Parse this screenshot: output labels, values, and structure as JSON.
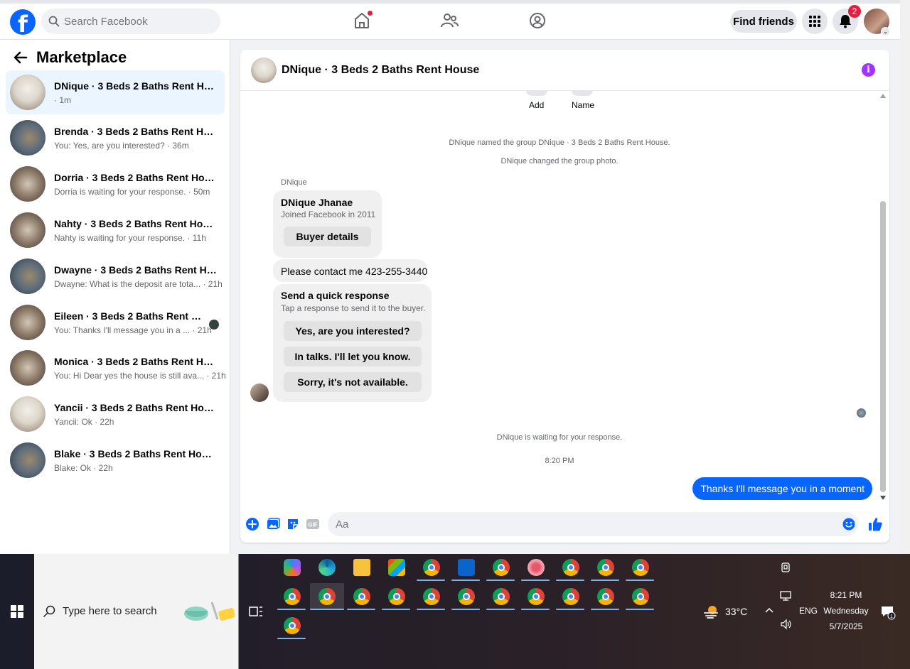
{
  "topbar": {
    "search_placeholder": "Search Facebook",
    "find_friends_label": "Find friends",
    "notifications_count": "2"
  },
  "sidebar": {
    "title": "Marketplace",
    "conversations": [
      {
        "name": "DNique · 3 Beds 2 Baths Rent House",
        "preview": "· 1m",
        "active": true
      },
      {
        "name": "Brenda · 3 Beds 2 Baths Rent House",
        "preview": "You: Yes, are you interested? · 36m"
      },
      {
        "name": "Dorria · 3 Beds 2 Baths Rent House",
        "preview": "Dorria is waiting for your response. · 50m"
      },
      {
        "name": "Nahty · 3 Beds 2 Baths Rent House",
        "preview": "Nahty is waiting for your response. · 11h"
      },
      {
        "name": "Dwayne · 3 Beds 2 Baths Rent House",
        "preview": "Dwayne: What is the deposit are tota... · 21h"
      },
      {
        "name": "Eileen · 3 Beds 2 Baths Rent Hou...",
        "preview": "You: Thanks I'll message you in a ... · 21h"
      },
      {
        "name": "Monica · 3 Beds 2 Baths Rent House",
        "preview": "You: Hi Dear yes the house is still ava... · 21h"
      },
      {
        "name": "Yancii · 3 Beds 2 Baths Rent House",
        "preview": "Yancii: Ok · 22h"
      },
      {
        "name": "Blake · 3 Beds 2 Baths Rent House",
        "preview": "Blake: Ok · 22h"
      }
    ]
  },
  "chat": {
    "title": "DNique · 3 Beds 2 Baths Rent House",
    "add_label": "Add",
    "name_label": "Name",
    "system_named": "DNique named the group DNique · 3 Beds 2 Baths Rent House.",
    "system_photo": "DNique changed the group photo.",
    "sender_name": "DNique",
    "profile_card": {
      "name": "DNique Jhanae",
      "joined": "Joined Facebook in 2011",
      "button": "Buyer details"
    },
    "contact_message": "Please contact me 423-255-3440",
    "quick_response": {
      "title": "Send a quick response",
      "subtitle": "Tap a response to send it to the buyer.",
      "options": [
        "Yes, are you interested?",
        "In talks. I'll let you know.",
        "Sorry, it's not available."
      ]
    },
    "waiting_text": "DNique is waiting for your response.",
    "timestamp": "8:20 PM",
    "outgoing_message": "Thanks I'll message you in a moment",
    "composer_placeholder": "Aa"
  },
  "taskbar": {
    "search_placeholder": "Type here to search",
    "weather": "33°C",
    "language": "ENG",
    "time": "8:21 PM",
    "day": "Wednesday",
    "date": "5/7/2025"
  }
}
